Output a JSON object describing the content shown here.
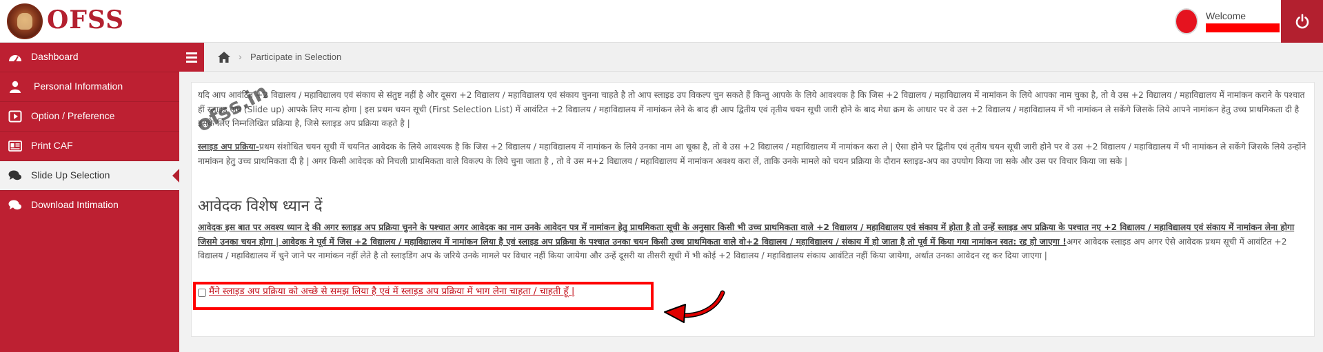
{
  "app": {
    "logo_text": "OFSS"
  },
  "header": {
    "welcome_text": "Welcome"
  },
  "colors": {
    "brand": "#bd2032",
    "accent": "#b3202f",
    "highlight": "#ff0000"
  },
  "sidebar": {
    "items": [
      {
        "label": "Dashboard",
        "icon": "dashboard-icon"
      },
      {
        "label": "Personal Information",
        "icon": "user-icon"
      },
      {
        "label": "Option / Preference",
        "icon": "play-square-icon"
      },
      {
        "label": "Print CAF",
        "icon": "id-card-icon"
      },
      {
        "label": "Slide Up Selection",
        "icon": "comments-icon",
        "active": true
      },
      {
        "label": "Download Intimation",
        "icon": "comments-icon"
      }
    ]
  },
  "breadcrumb": {
    "separator": "›",
    "current": "Participate in Selection"
  },
  "content": {
    "para1": "यदि आप आवंटित +2 विद्यालय / महाविद्यालय एवं संकाय से संतुष्ट नहीं है और दूसरा +2 विद्यालय / महाविद्यालय एवं संकाय चुनना चाहते है तो आप स्लाइड उप विकल्प चुन सकते हैं किन्तु आपके के लिये आवश्यक है कि जिस +2 विद्यालय / महाविद्यालय में नामांकन के लिये आपका नाम चुका है, तो वे उस +2 विद्यालय / महाविद्यालय में नामांकन कराने के पश्चात हीं स्लाइड अप (Slide up) आपके लिए मान्य होगा | इस प्रथम चयन सूची (First Selection List) में आवंटित +2 विद्यालय / महाविद्यालय में नामांकन लेने के बाद ही आप द्वितीय एवं तृतीय चयन सूची जारी होने के बाद मेधा क्रम के आधार पर वे उस +2 विद्यालय / महाविद्यालय में भी नामांकन ले सकेंगे जिसके लिये आपने नामांकन हेतु उच्च प्राथमिकता दी है इसके लिए निम्नलिखित प्रक्रिया है, जिसे स्लाइड अप प्रक्रिया कहते है |",
    "para2_lead": "स्लाइड अप प्रक्रिया-",
    "para2": "प्रथम संशोधित चयन सूची में चयनित आवेदक के लिये आवश्यक है कि जिस +2 विद्यालय / महाविद्यालय में नामांकन के लिये उनका नाम आ चूका है, तो वे उस +2 विद्यालय / महाविद्यालय में नामांकन करा ले | ऐसा होने पर द्वितीय एवं तृतीय चयन सूची जारी होने पर वे उस +2 विद्यालय / महाविद्यालय में भी नामांकन ले सकेंगे जिसके लिये उन्होंने नामांकन हेतु उच्च प्राथमिकता दी है | अगर किसी आवेदक को निचली प्राथमिकता वाले विकल्प के लिये चुना जाता है , तो वे उस म+2 विद्यालय / महाविद्यालय में नामांकन अवश्य करा लें, ताकि उनके मामले को चयन प्रक्रिया के दौरान स्लाइड-अप का उपयोग किया जा सके और उस पर विचार किया जा सके |",
    "heading": "आवेदक विशेष ध्यान दें",
    "para3_underlined": "आवेदक इस बात पर अवश्य ध्यान दे की अगर स्लाइड अप प्रक्रिया चुनने के पश्चात अगर आवेदक का नाम उनके आवेदन पत्र में नामांकन हेतु प्राथमिकता सूची के अनुसार किसी भी उच्च प्राथमिकता वाले +2 विद्यालय / महाविद्यालय एवं संकाय में होता है तो उन्हें स्लाइड अप प्रक्रिया के पश्चात नए +2 विद्यालय / महाविद्यालय एवं संकाय में नामांकन लेना होगा जिसमे उनका चयन होगा | आवेदक ने पूर्व में जिस +2 विद्यालय / महाविद्यालय में नामांकन लिया है एवं स्लाइड अप प्रक्रिया के पश्चात उनका चयन किसी उच्च प्राथमिकता वाले वो+2 विद्यालय / महाविद्यालय / संकाय में हो जाता है तो पूर्व में किया गया नामांकन स्वत: रद्द हो जाएगा !",
    "para3_rest": "अगर आवेदक स्लाइड अप अगर ऐसे आवेदक प्रथम सूची में आवंटित +2 विद्यालय / महाविद्यालय में चुने जाने पर नामांकन नहीं लेते है तो स्लाइडिंग अप के जरिये उनके मामले पर विचार नहीं किया जायेगा और उन्हें दूसरी या तीसरी सूची में भी कोई +2 विद्यालय / महाविद्यालय संकाय आवंटित नहीं किया जायेगा, अर्थात उनका आवेदन रद्द कर दिया जाएगा |",
    "consent_label": "मैंने स्लाइड अप प्रक्रिया को अच्छे से समझ लिया है एवं में स्लाइड अप प्रक्रिया में भाग लेना चाहता / चाहती हूँ |",
    "watermark": "ofss.in"
  }
}
